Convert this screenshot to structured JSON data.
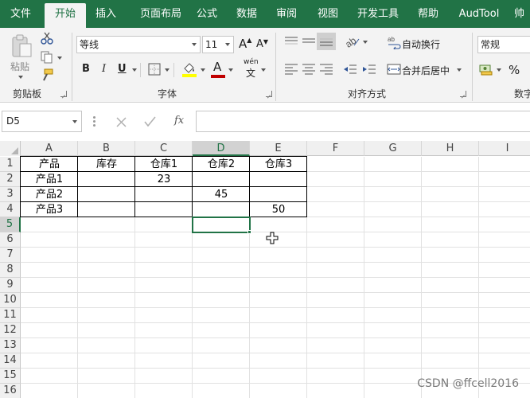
{
  "tabs": [
    "文件",
    "开始",
    "插入",
    "页面布局",
    "公式",
    "数据",
    "审阅",
    "视图",
    "开发工具",
    "帮助",
    "AudTool",
    "帅"
  ],
  "active_tab": "开始",
  "ribbon": {
    "clipboard": {
      "group_label": "剪贴板",
      "paste_label": "粘贴"
    },
    "font": {
      "group_label": "字体",
      "font_name": "等线",
      "font_size": "11",
      "grow_icon": "A",
      "shrink_icon": "A",
      "bold": "B",
      "italic": "I",
      "underline": "U",
      "font_color_letter": "A",
      "phonetic_top": "wén",
      "phonetic_bottom": "文",
      "font_color": "#c00000",
      "highlight_color": "#ffff00"
    },
    "alignment": {
      "group_label": "对齐方式",
      "wrap_text": "自动换行",
      "merge_center": "合并后居中"
    },
    "number": {
      "group_label": "数字",
      "format": "常规",
      "percent": "%"
    }
  },
  "formula_bar": {
    "name_box": "D5",
    "formula": "",
    "fx": "fx"
  },
  "sheet": {
    "columns": [
      "A",
      "B",
      "C",
      "D",
      "E",
      "F",
      "G",
      "H",
      "I"
    ],
    "rows": [
      "1",
      "2",
      "3",
      "4",
      "5",
      "6",
      "7",
      "8",
      "9",
      "10",
      "11",
      "12",
      "13",
      "14",
      "15",
      "16"
    ],
    "cells": {
      "A1": "产品",
      "B1": "库存",
      "C1": "仓库1",
      "D1": "仓库2",
      "E1": "仓库3",
      "A2": "产品1",
      "C2": "23",
      "A3": "产品2",
      "D3": "45",
      "A4": "产品3",
      "E4": "50"
    },
    "selected_cell": "D5",
    "accent_color": "#217346"
  },
  "watermark": "CSDN @ffcell2016"
}
